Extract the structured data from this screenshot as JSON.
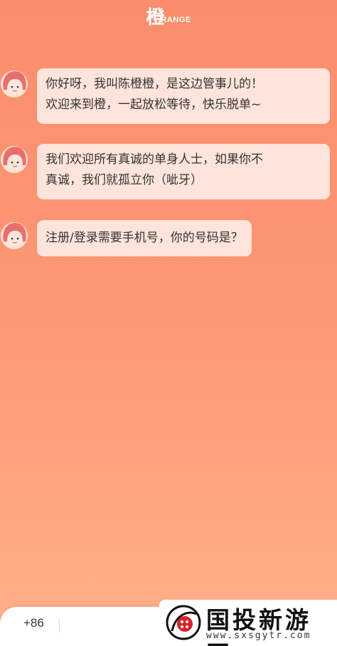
{
  "header": {
    "logo_char": "橙",
    "logo_word": "RANGE"
  },
  "messages": [
    {
      "line1": "你好呀，我叫陈橙橙，是这边管事儿的！",
      "line2": "欢迎来到橙，一起放松等待，快乐脱单~"
    },
    {
      "line1": "我们欢迎所有真诚的单身人士，如果你不",
      "line2": "真诚，我们就孤立你（呲牙）"
    },
    {
      "line1": "注册/登录需要手机号，你的号码是？"
    }
  ],
  "input": {
    "country_code": "+86",
    "value": ""
  },
  "watermark": {
    "title": "国投新游网",
    "url": "www.sxsgytr.com"
  },
  "colors": {
    "background_top": "#fb8d6d",
    "background_bottom": "#ffb08a",
    "bubble": "#fee4da",
    "avatar_hair": "#e96f6f"
  }
}
